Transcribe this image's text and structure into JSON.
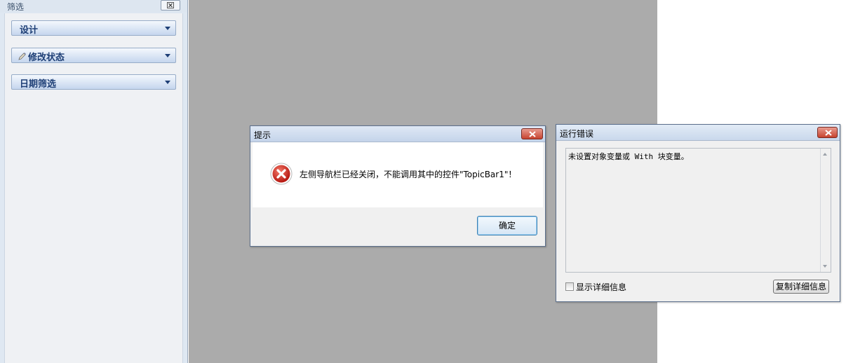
{
  "panel": {
    "title": "筛选",
    "close_label": "⊠",
    "sections": [
      {
        "label": "设计",
        "icon": ""
      },
      {
        "label": "修改状态",
        "icon": "pencil-icon"
      },
      {
        "label": "日期筛选",
        "icon": ""
      }
    ]
  },
  "prompt_dialog": {
    "title": "提示",
    "message": "左侧导航栏已经关闭，不能调用其中的控件\"TopicBar1\"！",
    "ok_label": "确定",
    "icon": "error-icon"
  },
  "error_dialog": {
    "title": "运行错误",
    "error_text": "未设置对象变量或 With 块变量。",
    "checkbox_label": "显示详细信息",
    "checkbox_checked": false,
    "copy_button_label": "复制详细信息"
  },
  "colors": {
    "section_text": "#1e3f76",
    "workspace": "#ababab",
    "close_red": "#c7432f"
  }
}
